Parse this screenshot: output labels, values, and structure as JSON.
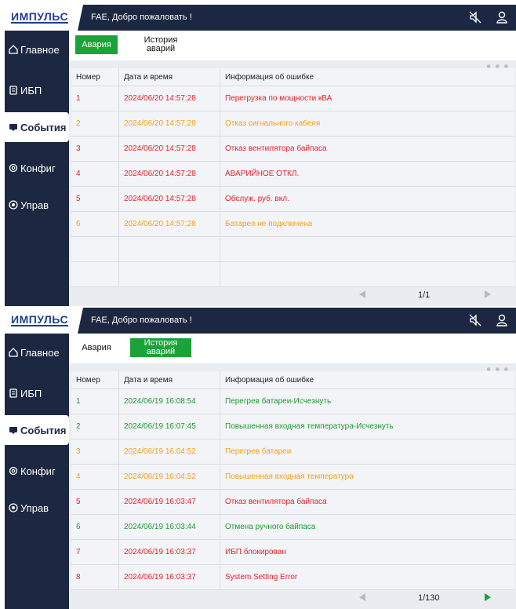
{
  "screens": [
    {
      "logo": "ИМПУЛЬС",
      "welcome": "FAE, Добро пожаловать !",
      "sidebar": [
        "Главное",
        "ИБП",
        "События",
        "Конфиг",
        "Управ"
      ],
      "active_sidebar_index": 2,
      "tabs": [
        {
          "label": "Авария",
          "active": true
        },
        {
          "label": "История\nаварий",
          "active": false
        }
      ],
      "columns": [
        "Номер",
        "Дата и время",
        "Информация об ошибке"
      ],
      "rows": [
        {
          "num": "1",
          "datetime": "2024/06/20 14:57:28",
          "info": "Перегрузка по мощности  кВА",
          "color": "#e0232b"
        },
        {
          "num": "2",
          "datetime": "2024/06/20 14:57:28",
          "info": "Отказ сигнального кабеля",
          "color": "#f0a21a"
        },
        {
          "num": "3",
          "datetime": "2024/06/20 14:57:28",
          "info": "Отказ вентилятора байпаса",
          "color": "#e0232b"
        },
        {
          "num": "4",
          "datetime": "2024/06/20 14:57:28",
          "info": "АВАРИЙНОЕ ОТКЛ.",
          "color": "#e0232b"
        },
        {
          "num": "5",
          "datetime": "2024/06/20 14:57:28",
          "info": "Обслуж. руб. вкл.",
          "color": "#e0232b"
        },
        {
          "num": "6",
          "datetime": "2024/06/20 14:57:28",
          "info": "Батарея не подключена",
          "color": "#f0a21a"
        },
        {
          "num": "",
          "datetime": "",
          "info": "",
          "color": ""
        },
        {
          "num": "",
          "datetime": "",
          "info": "",
          "color": ""
        }
      ],
      "page": "1/1",
      "next_enabled": false
    },
    {
      "logo": "ИМПУЛЬС",
      "welcome": "FAE, Добро пожаловать !",
      "sidebar": [
        "Главное",
        "ИБП",
        "События",
        "Конфиг",
        "Управ"
      ],
      "active_sidebar_index": 2,
      "tabs": [
        {
          "label": "Авария",
          "active": false
        },
        {
          "label": "История\nаварий",
          "active": true
        }
      ],
      "columns": [
        "Номер",
        "Дата и время",
        "Информация об ошибке"
      ],
      "rows": [
        {
          "num": "1",
          "datetime": "2024/06/19 16:08:54",
          "info": "Перегрев батареи-Исчезнуть",
          "color": "#1d9a33"
        },
        {
          "num": "2",
          "datetime": "2024/06/19 16:07:45",
          "info": "Повышенная входная температура-Исчезнуть",
          "color": "#1d9a33"
        },
        {
          "num": "3",
          "datetime": "2024/06/19 16:04:52",
          "info": "Перегрев батареи",
          "color": "#f0a21a"
        },
        {
          "num": "4",
          "datetime": "2024/06/19 16:04:52",
          "info": "Повышенная входная температура",
          "color": "#f0a21a"
        },
        {
          "num": "5",
          "datetime": "2024/06/19 16:03:47",
          "info": "Отказ вентилятора байпаса",
          "color": "#e0232b"
        },
        {
          "num": "6",
          "datetime": "2024/06/19 16:03:44",
          "info": "Отмена ручного байпаса",
          "color": "#1d9a33"
        },
        {
          "num": "7",
          "datetime": "2024/06/19 16:03:37",
          "info": "ИБП блокирован",
          "color": "#e0232b"
        },
        {
          "num": "8",
          "datetime": "2024/06/19 16:03:37",
          "info": "System Setting Error",
          "color": "#e0232b"
        }
      ],
      "page": "1/130",
      "next_enabled": true
    }
  ],
  "icons": {
    "mute": "speaker-muted-icon",
    "user": "user-icon",
    "sidebar": [
      "home-icon",
      "ups-icon",
      "events-icon",
      "config-icon",
      "control-icon"
    ]
  },
  "colors": {
    "navy": "#1c2841",
    "green": "#1ca23a",
    "red": "#e0232b",
    "orange": "#f0a21a"
  }
}
